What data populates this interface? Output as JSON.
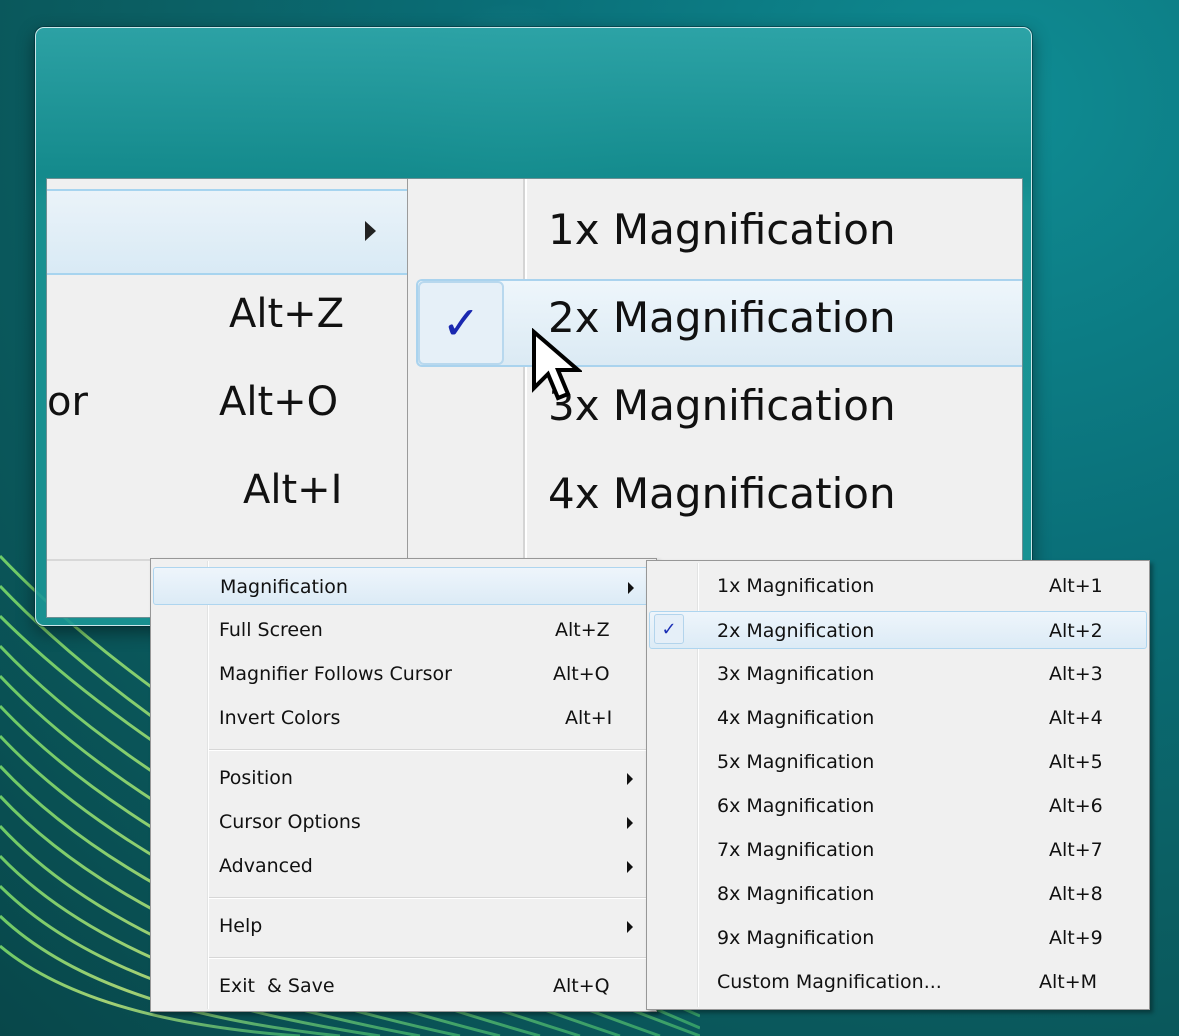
{
  "magnifier_view": {
    "left_items": [
      {
        "accel": ""
      },
      {
        "accel": "Alt+Z"
      },
      {
        "label_fragment": "or",
        "accel": "Alt+O"
      },
      {
        "accel": "Alt+I"
      }
    ],
    "right_items": [
      "1x Magnification",
      "2x Magnification",
      "3x Magnification",
      "4x Magnification"
    ],
    "check_glyph": "✓"
  },
  "context_menu": {
    "items": [
      {
        "label": "Magnification",
        "accel": "",
        "submenu": true,
        "highlighted": true
      },
      {
        "label": "Full Screen",
        "accel": "Alt+Z"
      },
      {
        "label": "Magnifier Follows Cursor",
        "accel": "Alt+O"
      },
      {
        "label": "Invert Colors",
        "accel": "Alt+I"
      },
      {
        "label": "Position",
        "accel": "",
        "submenu": true
      },
      {
        "label": "Cursor Options",
        "accel": "",
        "submenu": true
      },
      {
        "label": "Advanced",
        "accel": "",
        "submenu": true
      },
      {
        "label": "Help",
        "accel": "",
        "submenu": true
      },
      {
        "label": "Exit  & Save",
        "accel": "Alt+Q"
      }
    ]
  },
  "magnification_submenu": {
    "check_glyph": "✓",
    "checked_index": 1,
    "items": [
      {
        "label": "1x Magnification",
        "accel": "Alt+1"
      },
      {
        "label": "2x Magnification",
        "accel": "Alt+2"
      },
      {
        "label": "3x Magnification",
        "accel": "Alt+3"
      },
      {
        "label": "4x Magnification",
        "accel": "Alt+4"
      },
      {
        "label": "5x Magnification",
        "accel": "Alt+5"
      },
      {
        "label": "6x Magnification",
        "accel": "Alt+6"
      },
      {
        "label": "7x Magnification",
        "accel": "Alt+7"
      },
      {
        "label": "8x Magnification",
        "accel": "Alt+8"
      },
      {
        "label": "9x Magnification",
        "accel": "Alt+9"
      },
      {
        "label": "Custom Magnification...",
        "accel": "Alt+M"
      }
    ]
  },
  "colors": {
    "desktop": "#0a6f78",
    "menu_bg": "#f0f0f0",
    "highlight_border": "#aed5ef",
    "check": "#1b2fb5"
  }
}
